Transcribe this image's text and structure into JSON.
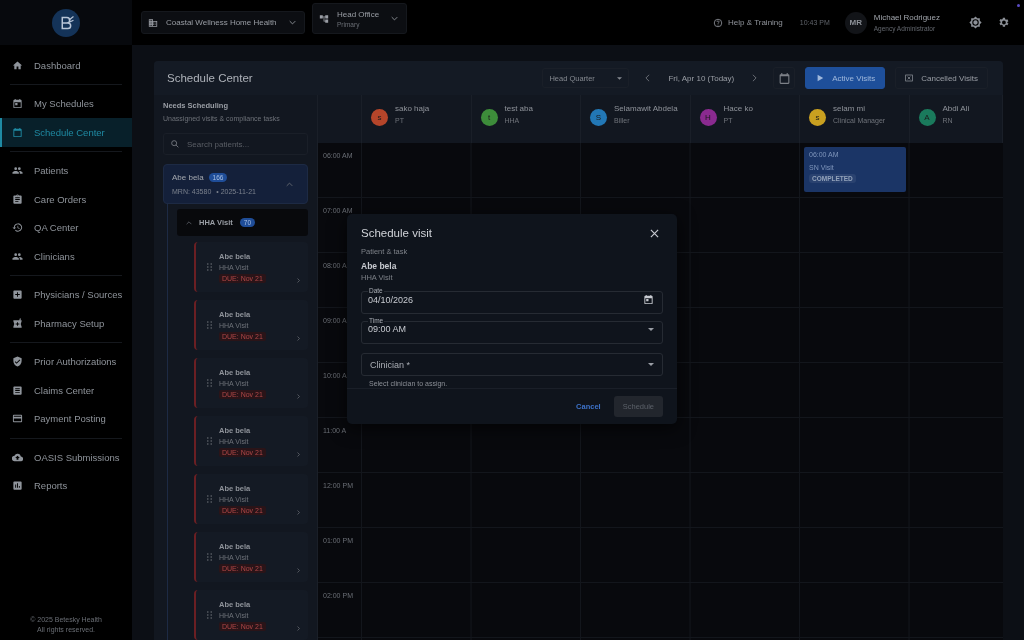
{
  "sidebar": {
    "sections": [
      {
        "items": [
          {
            "label": "Dashboard",
            "selected": false
          }
        ]
      },
      {
        "items": [
          {
            "label": "My Schedules",
            "selected": false
          },
          {
            "label": "Schedule Center",
            "selected": true
          }
        ]
      },
      {
        "items": [
          {
            "label": "Patients",
            "selected": false
          },
          {
            "label": "Care Orders",
            "selected": false
          },
          {
            "label": "QA Center",
            "selected": false
          },
          {
            "label": "Clinicians",
            "selected": false
          }
        ]
      },
      {
        "items": [
          {
            "label": "Physicians / Sources",
            "selected": false
          },
          {
            "label": "Pharmacy Setup",
            "selected": false
          }
        ]
      },
      {
        "items": [
          {
            "label": "Prior Authorizations",
            "selected": false
          },
          {
            "label": "Claims Center",
            "selected": false
          },
          {
            "label": "Payment Posting",
            "selected": false
          }
        ]
      },
      {
        "items": [
          {
            "label": "OASIS Submissions",
            "selected": false
          },
          {
            "label": "Reports",
            "selected": false
          }
        ]
      }
    ],
    "footer": [
      "© 2025 Betesky Health",
      "All rights reserved."
    ]
  },
  "topbar": {
    "organization": "Coastal Wellness Home Health",
    "office": {
      "name": "Head Office",
      "subtitle": "Primary"
    },
    "help": "Help & Training",
    "time": "10:43 PM",
    "user": {
      "initials": "MR",
      "name": "Michael Rodriguez",
      "role": "Agency Administrator"
    }
  },
  "schedule": {
    "title": "Schedule Center",
    "location": "Head Quarter",
    "date": "Fri, Apr 10 (Today)",
    "buttons": [
      {
        "label": "Active Visits",
        "selected": true
      },
      {
        "label": "Cancelled Visits",
        "selected": false
      }
    ]
  },
  "needs_scheduling": {
    "title": "Needs Scheduling",
    "subtitle": "Unassigned visits & compliance tasks",
    "search": {
      "placeholder": "Search patients..."
    },
    "patient": {
      "name": "Abe bela",
      "count": "166",
      "mrn": "MRN: 43580",
      "date": "• 2025-11-21",
      "expanded": true
    },
    "group": {
      "label": "HHA Visit",
      "count": "70",
      "expanded": true
    },
    "tasks": [
      {
        "name": "Abe bela",
        "type": "HHA Visit",
        "due": "DUE: Nov 21"
      },
      {
        "name": "Abe bela",
        "type": "HHA Visit",
        "due": "DUE: Nov 21"
      },
      {
        "name": "Abe bela",
        "type": "HHA Visit",
        "due": "DUE: Nov 21"
      },
      {
        "name": "Abe bela",
        "type": "HHA Visit",
        "due": "DUE: Nov 21"
      },
      {
        "name": "Abe bela",
        "type": "HHA Visit",
        "due": "DUE: Nov 21"
      },
      {
        "name": "Abe bela",
        "type": "HHA Visit",
        "due": "DUE: Nov 21"
      },
      {
        "name": "Abe bela",
        "type": "HHA Visit",
        "due": "DUE: Nov 21"
      }
    ]
  },
  "clinicians": [
    {
      "initial": "s",
      "name": "sako haja",
      "role": "PT",
      "color": "#b5452a"
    },
    {
      "initial": "t",
      "name": "test aba",
      "role": "HHA",
      "color": "#3d8c3a"
    },
    {
      "initial": "S",
      "name": "Selamawit Abdela",
      "role": "Biller",
      "color": "#2277b5"
    },
    {
      "initial": "H",
      "name": "Hace ko",
      "role": "PT",
      "color": "#8a2a8f"
    },
    {
      "initial": "s",
      "name": "selam mi",
      "role": "Clinical Manager",
      "color": "#c9a020",
      "events": [
        {
          "time": "06:00 AM",
          "title": "SN Visit",
          "status": "COMPLETED"
        }
      ]
    },
    {
      "initial": "A",
      "name": "Abdi Ali",
      "role": "RN",
      "color": "#1a7a5c"
    }
  ],
  "times": [
    "06:00 AM",
    "07:00 AM",
    "08:00 A",
    "09:00 A",
    "10:00 A",
    "11:00 A",
    "12:00 PM",
    "01:00 PM",
    "02:00 PM"
  ],
  "modal": {
    "title": "Schedule visit",
    "section": "Patient & task",
    "patient": "Abe bela",
    "task": "HHA Visit",
    "date": {
      "label": "Date",
      "value": "04/10/2026"
    },
    "time": {
      "label": "Time",
      "value": "09:00 AM"
    },
    "clinician": {
      "label": "Clinician *",
      "helper": "Select clinician to assign."
    },
    "cancel": "Cancel",
    "submit": {
      "label": "Schedule",
      "disabled": true
    }
  }
}
